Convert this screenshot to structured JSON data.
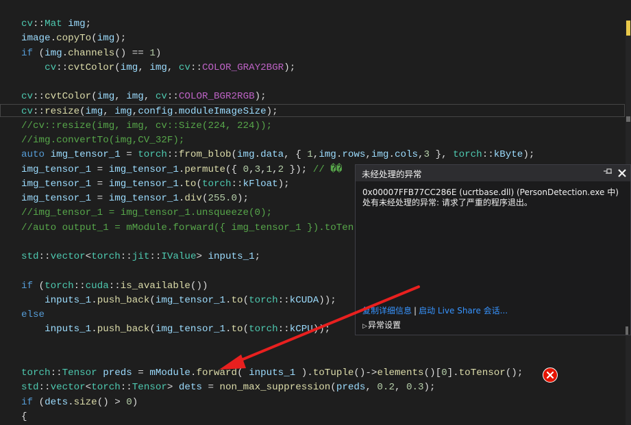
{
  "editor": {
    "lines": [
      [
        [
          "ty",
          "cv"
        ],
        [
          "pl",
          "::"
        ],
        [
          "ty",
          "Mat"
        ],
        [
          "pl",
          " "
        ],
        [
          "va",
          "img"
        ],
        [
          "pl",
          ";"
        ]
      ],
      [
        [
          "va",
          "image"
        ],
        [
          "pl",
          "."
        ],
        [
          "fn",
          "copyTo"
        ],
        [
          "pl",
          "("
        ],
        [
          "va",
          "img"
        ],
        [
          "pl",
          ");"
        ]
      ],
      [
        [
          "kw",
          "if"
        ],
        [
          "pl",
          " ("
        ],
        [
          "va",
          "img"
        ],
        [
          "pl",
          "."
        ],
        [
          "fn",
          "channels"
        ],
        [
          "pl",
          "() == "
        ],
        [
          "nu",
          "1"
        ],
        [
          "pl",
          ")"
        ]
      ],
      [
        [
          "pl",
          "    "
        ],
        [
          "ty",
          "cv"
        ],
        [
          "pl",
          "::"
        ],
        [
          "fn",
          "cvtColor"
        ],
        [
          "pl",
          "("
        ],
        [
          "va",
          "img"
        ],
        [
          "pl",
          ", "
        ],
        [
          "va",
          "img"
        ],
        [
          "pl",
          ", "
        ],
        [
          "ty",
          "cv"
        ],
        [
          "pl",
          "::"
        ],
        [
          "ma",
          "COLOR_GRAY2BGR"
        ],
        [
          "pl",
          ");"
        ]
      ],
      [],
      [
        [
          "ty",
          "cv"
        ],
        [
          "pl",
          "::"
        ],
        [
          "fn",
          "cvtColor"
        ],
        [
          "pl",
          "("
        ],
        [
          "va",
          "img"
        ],
        [
          "pl",
          ", "
        ],
        [
          "va",
          "img"
        ],
        [
          "pl",
          ", "
        ],
        [
          "ty",
          "cv"
        ],
        [
          "pl",
          "::"
        ],
        [
          "ma",
          "COLOR_BGR2RGB"
        ],
        [
          "pl",
          ");"
        ]
      ],
      [
        [
          "ty",
          "cv"
        ],
        [
          "pl",
          "::"
        ],
        [
          "fn",
          "resize"
        ],
        [
          "pl",
          "("
        ],
        [
          "va",
          "img"
        ],
        [
          "pl",
          ", "
        ],
        [
          "va",
          "img"
        ],
        [
          "pl",
          ","
        ],
        [
          "va",
          "config"
        ],
        [
          "pl",
          "."
        ],
        [
          "va",
          "moduleImageSize"
        ],
        [
          "pl",
          ");"
        ]
      ],
      [
        [
          "co",
          "//cv::resize(img, img, cv::Size(224, 224));"
        ]
      ],
      [
        [
          "co",
          "//img.convertTo(img,CV_32F);"
        ]
      ],
      [
        [
          "kw",
          "auto"
        ],
        [
          "pl",
          " "
        ],
        [
          "va",
          "img_tensor_1"
        ],
        [
          "pl",
          " = "
        ],
        [
          "ty",
          "torch"
        ],
        [
          "pl",
          "::"
        ],
        [
          "fn",
          "from_blob"
        ],
        [
          "pl",
          "("
        ],
        [
          "va",
          "img"
        ],
        [
          "pl",
          "."
        ],
        [
          "va",
          "data"
        ],
        [
          "pl",
          ", { "
        ],
        [
          "nu",
          "1"
        ],
        [
          "pl",
          ","
        ],
        [
          "va",
          "img"
        ],
        [
          "pl",
          "."
        ],
        [
          "va",
          "rows"
        ],
        [
          "pl",
          ","
        ],
        [
          "va",
          "img"
        ],
        [
          "pl",
          "."
        ],
        [
          "va",
          "cols"
        ],
        [
          "pl",
          ","
        ],
        [
          "nu",
          "3"
        ],
        [
          "pl",
          " }, "
        ],
        [
          "ty",
          "torch"
        ],
        [
          "pl",
          "::"
        ],
        [
          "va",
          "kByte"
        ],
        [
          "pl",
          ");"
        ]
      ],
      [
        [
          "va",
          "img_tensor_1"
        ],
        [
          "pl",
          " = "
        ],
        [
          "va",
          "img_tensor_1"
        ],
        [
          "pl",
          "."
        ],
        [
          "fn",
          "permute"
        ],
        [
          "pl",
          "({ "
        ],
        [
          "nu",
          "0"
        ],
        [
          "pl",
          ","
        ],
        [
          "nu",
          "3"
        ],
        [
          "pl",
          ","
        ],
        [
          "nu",
          "1"
        ],
        [
          "pl",
          ","
        ],
        [
          "nu",
          "2"
        ],
        [
          "pl",
          " }); "
        ],
        [
          "co",
          "// ��"
        ]
      ],
      [
        [
          "va",
          "img_tensor_1"
        ],
        [
          "pl",
          " = "
        ],
        [
          "va",
          "img_tensor_1"
        ],
        [
          "pl",
          "."
        ],
        [
          "fn",
          "to"
        ],
        [
          "pl",
          "("
        ],
        [
          "ty",
          "torch"
        ],
        [
          "pl",
          "::"
        ],
        [
          "va",
          "kFloat"
        ],
        [
          "pl",
          ");"
        ]
      ],
      [
        [
          "va",
          "img_tensor_1"
        ],
        [
          "pl",
          " = "
        ],
        [
          "va",
          "img_tensor_1"
        ],
        [
          "pl",
          "."
        ],
        [
          "fn",
          "div"
        ],
        [
          "pl",
          "("
        ],
        [
          "nu",
          "255.0"
        ],
        [
          "pl",
          ");"
        ]
      ],
      [
        [
          "co",
          "//img_tensor_1 = img_tensor_1.unsqueeze(0);"
        ]
      ],
      [
        [
          "co",
          "//auto output_1 = mModule.forward({ img_tensor_1 }).toTen"
        ]
      ],
      [],
      [
        [
          "ty",
          "std"
        ],
        [
          "pl",
          "::"
        ],
        [
          "ty",
          "vector"
        ],
        [
          "pl",
          "<"
        ],
        [
          "ty",
          "torch"
        ],
        [
          "pl",
          "::"
        ],
        [
          "ty",
          "jit"
        ],
        [
          "pl",
          "::"
        ],
        [
          "ty",
          "IValue"
        ],
        [
          "pl",
          "> "
        ],
        [
          "va",
          "inputs_1"
        ],
        [
          "pl",
          ";"
        ]
      ],
      [],
      [
        [
          "kw",
          "if"
        ],
        [
          "pl",
          " ("
        ],
        [
          "ty",
          "torch"
        ],
        [
          "pl",
          "::"
        ],
        [
          "ty",
          "cuda"
        ],
        [
          "pl",
          "::"
        ],
        [
          "fn",
          "is_available"
        ],
        [
          "pl",
          "())"
        ]
      ],
      [
        [
          "pl",
          "    "
        ],
        [
          "va",
          "inputs_1"
        ],
        [
          "pl",
          "."
        ],
        [
          "fn",
          "push_back"
        ],
        [
          "pl",
          "("
        ],
        [
          "va",
          "img_tensor_1"
        ],
        [
          "pl",
          "."
        ],
        [
          "fn",
          "to"
        ],
        [
          "pl",
          "("
        ],
        [
          "ty",
          "torch"
        ],
        [
          "pl",
          "::"
        ],
        [
          "va",
          "kCUDA"
        ],
        [
          "pl",
          "));"
        ]
      ],
      [
        [
          "kw",
          "else"
        ]
      ],
      [
        [
          "pl",
          "    "
        ],
        [
          "va",
          "inputs_1"
        ],
        [
          "pl",
          "."
        ],
        [
          "fn",
          "push_back"
        ],
        [
          "pl",
          "("
        ],
        [
          "va",
          "img_tensor_1"
        ],
        [
          "pl",
          "."
        ],
        [
          "fn",
          "to"
        ],
        [
          "pl",
          "("
        ],
        [
          "ty",
          "torch"
        ],
        [
          "pl",
          "::"
        ],
        [
          "va",
          "kCPU"
        ],
        [
          "pl",
          "));"
        ]
      ],
      [],
      [],
      [
        [
          "ty",
          "torch"
        ],
        [
          "pl",
          "::"
        ],
        [
          "ty",
          "Tensor"
        ],
        [
          "pl",
          " "
        ],
        [
          "va",
          "preds"
        ],
        [
          "pl",
          " = "
        ],
        [
          "va",
          "mModule"
        ],
        [
          "pl",
          "."
        ],
        [
          "fn",
          "forward"
        ],
        [
          "pl",
          "( "
        ],
        [
          "va",
          "inputs_1"
        ],
        [
          "pl",
          " )."
        ],
        [
          "fn",
          "toTuple"
        ],
        [
          "pl",
          "()->"
        ],
        [
          "fn",
          "elements"
        ],
        [
          "pl",
          "()["
        ],
        [
          "nu",
          "0"
        ],
        [
          "pl",
          "]."
        ],
        [
          "fn",
          "toTensor"
        ],
        [
          "pl",
          "();"
        ]
      ],
      [
        [
          "ty",
          "std"
        ],
        [
          "pl",
          "::"
        ],
        [
          "ty",
          "vector"
        ],
        [
          "pl",
          "<"
        ],
        [
          "ty",
          "torch"
        ],
        [
          "pl",
          "::"
        ],
        [
          "ty",
          "Tensor"
        ],
        [
          "pl",
          "> "
        ],
        [
          "va",
          "dets"
        ],
        [
          "pl",
          " = "
        ],
        [
          "fn",
          "non_max_suppression"
        ],
        [
          "pl",
          "("
        ],
        [
          "va",
          "preds"
        ],
        [
          "pl",
          ", "
        ],
        [
          "nu",
          "0.2"
        ],
        [
          "pl",
          ", "
        ],
        [
          "nu",
          "0.3"
        ],
        [
          "pl",
          ");"
        ]
      ],
      [
        [
          "kw",
          "if"
        ],
        [
          "pl",
          " ("
        ],
        [
          "va",
          "dets"
        ],
        [
          "pl",
          "."
        ],
        [
          "fn",
          "size"
        ],
        [
          "pl",
          "() > "
        ],
        [
          "nu",
          "0"
        ],
        [
          "pl",
          ")"
        ]
      ],
      [
        [
          "pl",
          "{"
        ]
      ]
    ]
  },
  "exception_popup": {
    "title": "未经处理的异常",
    "message": "0x00007FFB77CC286E (ucrtbase.dll) (PersonDetection.exe 中)处有未经处理的异常: 请求了严重的程序退出。",
    "link_copy_details": "复制详细信息",
    "link_live_share": "启动 Live Share 会话...",
    "settings_label": "异常设置",
    "pin_icon": "pin-icon",
    "close_icon": "close-icon"
  },
  "error_glyph": {
    "icon": "error-circle-icon",
    "color": "#e51400"
  },
  "annotation": {
    "color": "#e8201f"
  },
  "colors": {
    "background": "#1e1e1e",
    "keyword": "#569cd6",
    "type": "#4ec9b0",
    "function": "#dcdcaa",
    "variable": "#9cdcfe",
    "number": "#b5cea8",
    "comment": "#57a64a",
    "macro": "#bd63c5",
    "link": "#3794ff"
  }
}
